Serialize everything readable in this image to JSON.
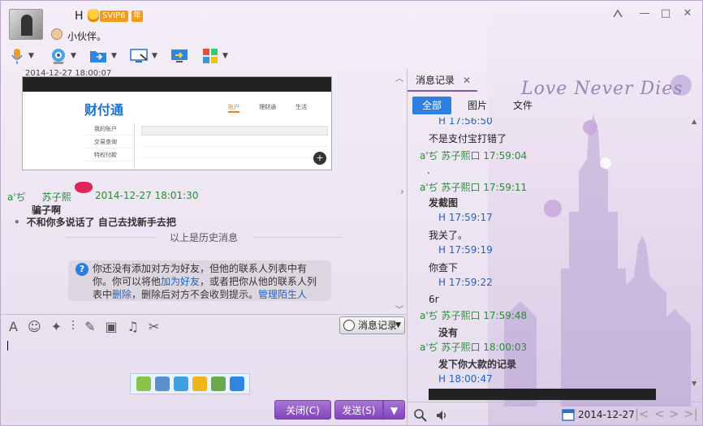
{
  "title": {
    "username": "H",
    "svip_label": "SVIP6",
    "year_label": "年",
    "signature": "小伙伴。"
  },
  "window_controls": {
    "restore": "□",
    "close": "✕",
    "minimize": "—"
  },
  "chat": {
    "cut_timestamp": "2014-12-27 18:00:07",
    "sender_mark": "a'ぢ",
    "sender_name": "苏子熙",
    "sender_time": "2014-12-27  18:01:30",
    "messages": [
      "骗子啊",
      "不和你多说话了 自己去找新手去把"
    ],
    "history_divider": "以上是历史消息",
    "notice_parts": {
      "a": "你还没有添加对方为好友，但他的联系人列表中有你。你可以将他",
      "link1": "加为好友",
      "b": "，或者把你从他的联系人列表中",
      "link2": "删除",
      "c": "，删除后对方不会收到提示。",
      "link3": "管理陌生人"
    },
    "screenshot_nav": [
      "账户",
      "理财通",
      "生活"
    ],
    "screenshot_side": [
      "我的账户",
      "交易查询",
      "特权付款"
    ],
    "screenshot_logo": "财付通"
  },
  "composer": {
    "history_button": "消息记录",
    "close_button": "关闭(C)",
    "send_button": "发送(S)"
  },
  "history": {
    "tab_label": "消息记录",
    "filters": [
      "全部",
      "图片",
      "文件"
    ],
    "records": [
      {
        "t": "H 17:56:50",
        "c": "b"
      },
      {
        "t": "不是支付宝打错了",
        "c": "k"
      },
      {
        "t": "a'ぢ    苏子熙口 17:59:04",
        "c": "g"
      },
      {
        "t": ".",
        "c": "k"
      },
      {
        "t": "a'ぢ    苏子熙口 17:59:11",
        "c": "g"
      },
      {
        "t": "发截图",
        "c": "bold"
      },
      {
        "t": "H 17:59:17",
        "c": "b"
      },
      {
        "t": "我关了。",
        "c": "k"
      },
      {
        "t": "H 17:59:19",
        "c": "b"
      },
      {
        "t": "你查下",
        "c": "k"
      },
      {
        "t": "H 17:59:22",
        "c": "b"
      },
      {
        "t": "6r",
        "c": "k"
      },
      {
        "t": "a'ぢ    苏子熙口 17:59:48",
        "c": "g"
      },
      {
        "t": "没有",
        "c": "bold"
      },
      {
        "t": "a'ぢ    苏子熙口 18:00:03",
        "c": "g"
      },
      {
        "t": "发下你大款的记录",
        "c": "bold"
      },
      {
        "t": "H 18:00:47",
        "c": "b"
      }
    ],
    "date": "2014-12-27"
  },
  "skin_text": "Love Never Dies",
  "colors": {
    "accent": "#8046b8",
    "history_tab": "#2f7fe0",
    "sender": "#2d8a39",
    "self": "#1d63c9"
  }
}
